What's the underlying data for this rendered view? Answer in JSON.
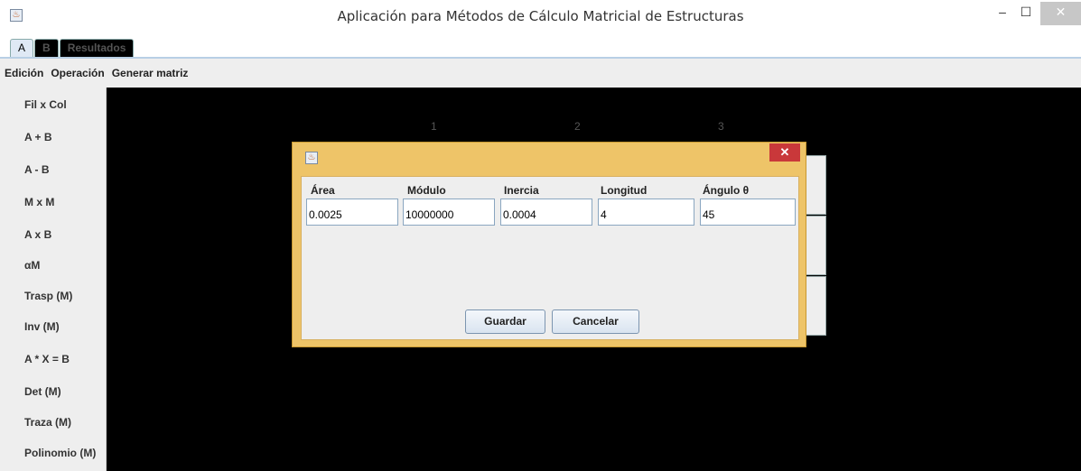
{
  "window": {
    "title": "Aplicación para Métodos de Cálculo Matricial de Estructuras",
    "icon": "java-cup-icon",
    "minimize": "–",
    "maximize": "☐",
    "close": "✕"
  },
  "tabs": [
    {
      "label": "A",
      "active": true
    },
    {
      "label": "B",
      "active": false
    },
    {
      "label": "Resultados",
      "active": false
    }
  ],
  "menu": [
    "Edición",
    "Operación",
    "Generar matriz"
  ],
  "sidebar": [
    "Fil x Col",
    "A + B",
    "A - B",
    "M x M",
    "A x B",
    "αM",
    "Trasp (M)",
    "Inv (M)",
    "A * X = B",
    "Det (M)",
    "Traza (M)",
    "Polinomio (M)"
  ],
  "matrix": {
    "column_headers": [
      "1",
      "2",
      "3"
    ]
  },
  "dialog": {
    "icon": "java-cup-icon",
    "close": "✕",
    "fields": [
      {
        "label": "Área",
        "value": "0.0025"
      },
      {
        "label": "Módulo",
        "value": "10000000"
      },
      {
        "label": "Inercia",
        "value": "0.0004"
      },
      {
        "label": "Longitud",
        "value": "4"
      },
      {
        "label": "Ángulo θ",
        "value": "45"
      }
    ],
    "save_label": "Guardar",
    "cancel_label": "Cancelar"
  }
}
